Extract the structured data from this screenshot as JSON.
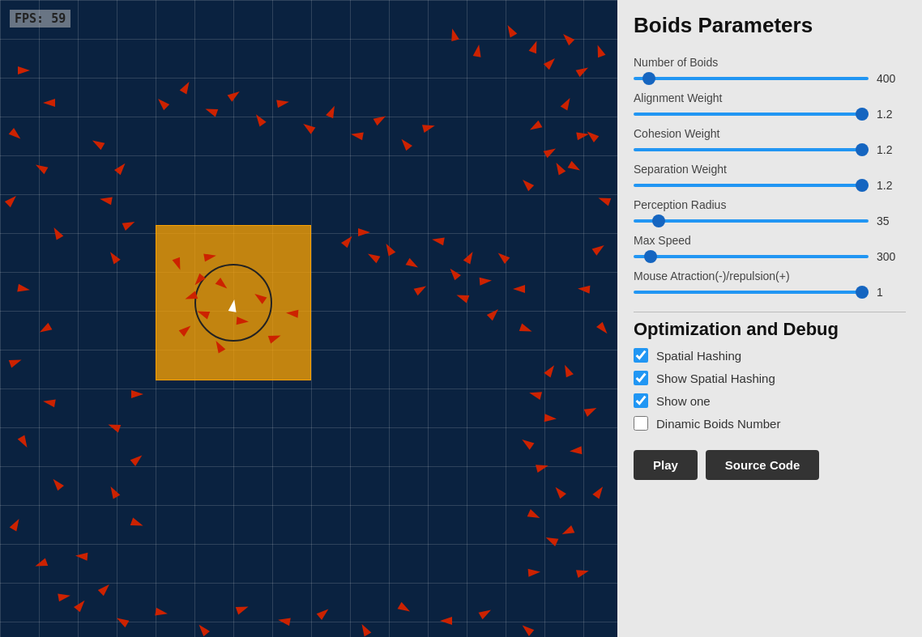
{
  "fps": {
    "label": "FPS: 59"
  },
  "panel": {
    "title": "Boids Parameters",
    "params": [
      {
        "id": "num-boids",
        "label": "Number of Boids",
        "value": "400",
        "min": 1,
        "max": 1000,
        "position": 40
      },
      {
        "id": "alignment",
        "label": "Alignment Weight",
        "value": "1.2",
        "min": 0,
        "max": 5,
        "position": 55
      },
      {
        "id": "cohesion",
        "label": "Cohesion Weight",
        "value": "1.2",
        "min": 0,
        "max": 5,
        "position": 55
      },
      {
        "id": "separation",
        "label": "Separation Weight",
        "value": "1.2",
        "min": 0,
        "max": 5,
        "position": 55
      },
      {
        "id": "perception",
        "label": "Perception Radius",
        "value": "35",
        "min": 0,
        "max": 200,
        "position": 17
      },
      {
        "id": "max-speed",
        "label": "Max Speed",
        "value": "300",
        "min": 0,
        "max": 1000,
        "position": 47
      },
      {
        "id": "mouse-attraction",
        "label": "Mouse Atraction(-)/repulsion(+)",
        "value": "1",
        "min": -5,
        "max": 5,
        "position": 60
      }
    ],
    "optimization_title": "Optimization and Debug",
    "checkboxes": [
      {
        "id": "spatial-hashing",
        "label": "Spatial Hashing",
        "checked": true
      },
      {
        "id": "show-spatial-hashing",
        "label": "Show Spatial Hashing",
        "checked": true
      },
      {
        "id": "show-one",
        "label": "Show one",
        "checked": true
      },
      {
        "id": "dynamic-boids",
        "label": "Dinamic Boids Number",
        "checked": false
      }
    ],
    "buttons": [
      {
        "id": "play-btn",
        "label": "Play"
      },
      {
        "id": "source-btn",
        "label": "Source Code"
      }
    ]
  }
}
